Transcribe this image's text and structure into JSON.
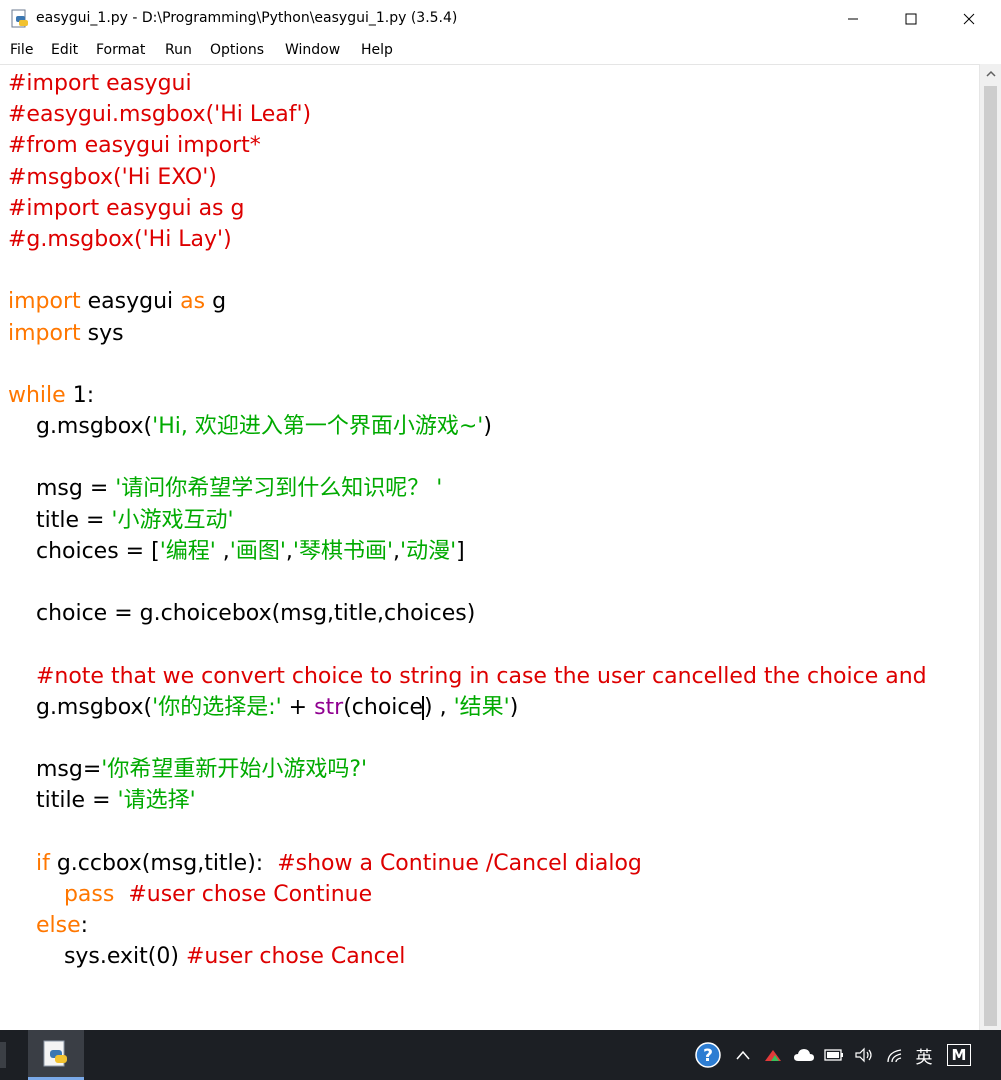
{
  "window": {
    "title": "easygui_1.py - D:\\Programming\\Python\\easygui_1.py (3.5.4)",
    "minimize_glyph": "—",
    "maximize_glyph": "☐",
    "close_glyph": "✕"
  },
  "menu": [
    "File",
    "Edit",
    "Format",
    "Run",
    "Options",
    "Window",
    "Help"
  ],
  "code_lines": [
    [
      {
        "t": "#import easygui",
        "c": "comment"
      }
    ],
    [
      {
        "t": "#easygui.msgbox('Hi Leaf')",
        "c": "comment"
      }
    ],
    [
      {
        "t": "#from easygui import*",
        "c": "comment"
      }
    ],
    [
      {
        "t": "#msgbox('Hi EXO')",
        "c": "comment"
      }
    ],
    [
      {
        "t": "#import easygui as g",
        "c": "comment"
      }
    ],
    [
      {
        "t": "#g.msgbox('Hi Lay')",
        "c": "comment"
      }
    ],
    [],
    [
      {
        "t": "import",
        "c": "keyword"
      },
      {
        "t": " easygui ",
        "c": "default"
      },
      {
        "t": "as",
        "c": "keyword"
      },
      {
        "t": " g",
        "c": "default"
      }
    ],
    [
      {
        "t": "import",
        "c": "keyword"
      },
      {
        "t": " sys",
        "c": "default"
      }
    ],
    [],
    [
      {
        "t": "while",
        "c": "keyword"
      },
      {
        "t": " 1:",
        "c": "default"
      }
    ],
    [
      {
        "t": "    g.msgbox(",
        "c": "default"
      },
      {
        "t": "'Hi, 欢迎进入第一个界面小游戏~'",
        "c": "string"
      },
      {
        "t": ")",
        "c": "default"
      }
    ],
    [],
    [
      {
        "t": "    msg = ",
        "c": "default"
      },
      {
        "t": "'请问你希望学习到什么知识呢？ '",
        "c": "string"
      }
    ],
    [
      {
        "t": "    title = ",
        "c": "default"
      },
      {
        "t": "'小游戏互动'",
        "c": "string"
      }
    ],
    [
      {
        "t": "    choices = [",
        "c": "default"
      },
      {
        "t": "'编程'",
        "c": "string"
      },
      {
        "t": " ,",
        "c": "default"
      },
      {
        "t": "'画图'",
        "c": "string"
      },
      {
        "t": ",",
        "c": "default"
      },
      {
        "t": "'琴棋书画'",
        "c": "string"
      },
      {
        "t": ",",
        "c": "default"
      },
      {
        "t": "'动漫'",
        "c": "string"
      },
      {
        "t": "]",
        "c": "default"
      }
    ],
    [],
    [
      {
        "t": "    choice = g.choicebox(msg,title,choices)",
        "c": "default"
      }
    ],
    [],
    [
      {
        "t": "    #note that we convert choice to string in case the user cancelled the choice and",
        "c": "comment"
      }
    ],
    [
      {
        "t": "    g.msgbox(",
        "c": "default"
      },
      {
        "t": "'你的选择是:'",
        "c": "string"
      },
      {
        "t": " + ",
        "c": "default"
      },
      {
        "t": "str",
        "c": "builtin"
      },
      {
        "t": "(choice",
        "c": "default"
      },
      {
        "t": "",
        "c": "caret"
      },
      {
        "t": ") , ",
        "c": "default"
      },
      {
        "t": "'结果'",
        "c": "string"
      },
      {
        "t": ")",
        "c": "default"
      }
    ],
    [],
    [
      {
        "t": "    msg=",
        "c": "default"
      },
      {
        "t": "'你希望重新开始小游戏吗?'",
        "c": "string"
      }
    ],
    [
      {
        "t": "    titile = ",
        "c": "default"
      },
      {
        "t": "'请选择'",
        "c": "string"
      }
    ],
    [],
    [
      {
        "t": "    ",
        "c": "default"
      },
      {
        "t": "if",
        "c": "keyword"
      },
      {
        "t": " g.ccbox(msg,title):  ",
        "c": "default"
      },
      {
        "t": "#show a Continue /Cancel dialog",
        "c": "comment"
      }
    ],
    [
      {
        "t": "        ",
        "c": "default"
      },
      {
        "t": "pass",
        "c": "keyword"
      },
      {
        "t": "  ",
        "c": "default"
      },
      {
        "t": "#user chose Continue",
        "c": "comment"
      }
    ],
    [
      {
        "t": "    ",
        "c": "default"
      },
      {
        "t": "else",
        "c": "keyword"
      },
      {
        "t": ":",
        "c": "default"
      }
    ],
    [
      {
        "t": "        sys.exit(0) ",
        "c": "default"
      },
      {
        "t": "#user chose Cancel",
        "c": "comment"
      }
    ]
  ],
  "taskbar": {
    "help_glyph": "?",
    "chevron_glyph": "∧",
    "ime_label": "英",
    "m_label": "M"
  },
  "colors": {
    "comment": "#dd0000",
    "keyword": "#ff7700",
    "string": "#00aa00",
    "builtin": "#900090",
    "taskbar": "#1c1f24"
  }
}
